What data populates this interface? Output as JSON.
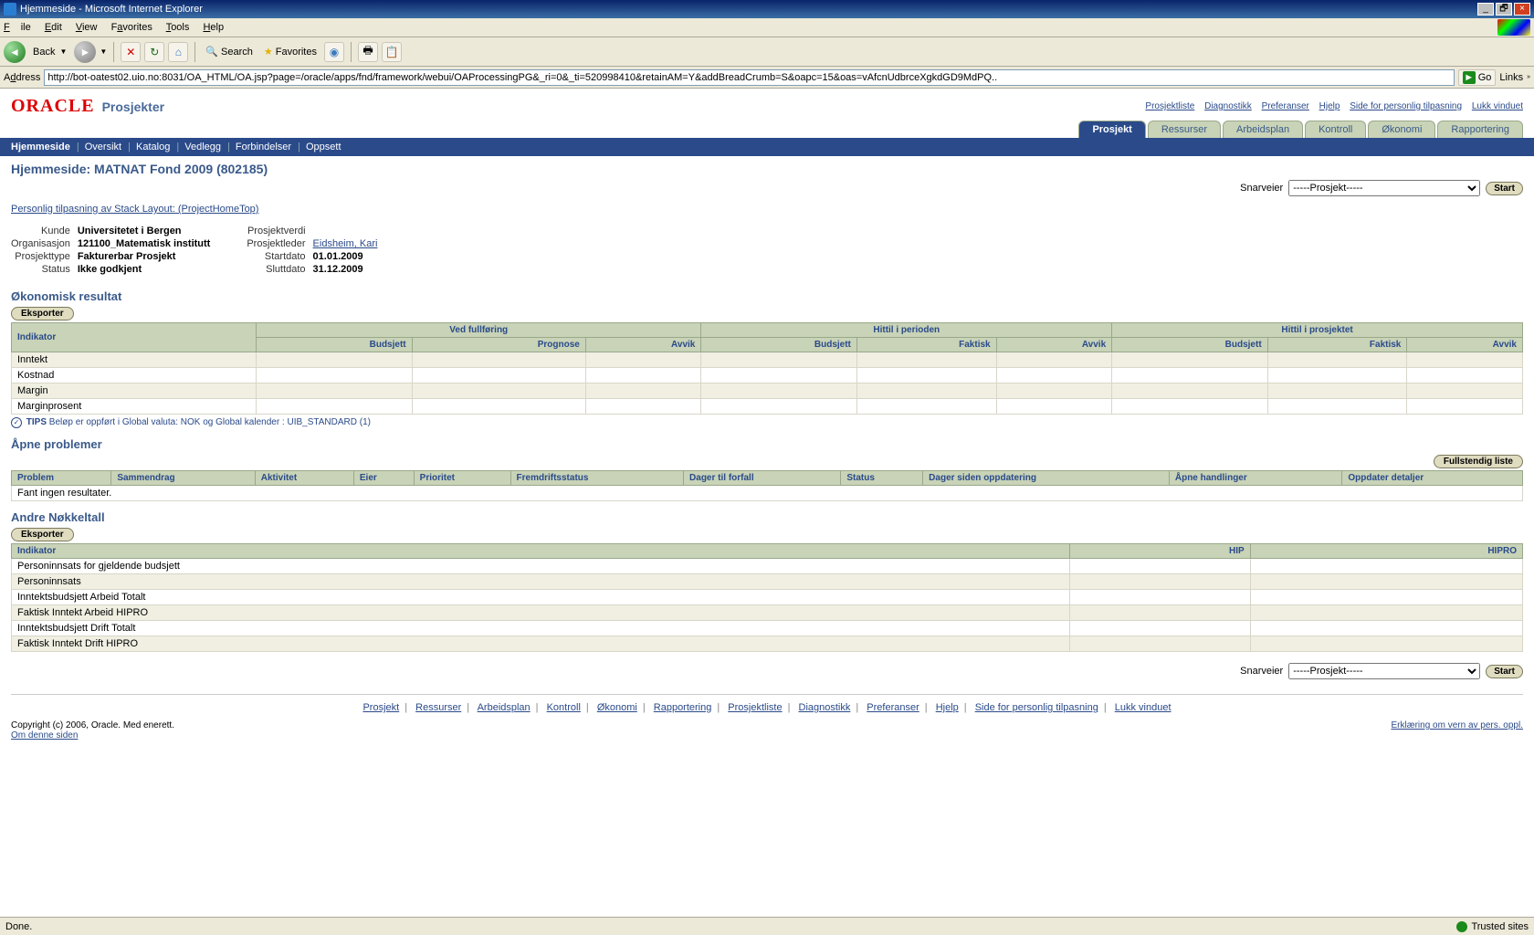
{
  "window": {
    "title": "Hjemmeside - Microsoft Internet Explorer"
  },
  "iemenu": {
    "file": "File",
    "edit": "Edit",
    "view": "View",
    "favorites": "Favorites",
    "tools": "Tools",
    "help": "Help"
  },
  "ietool": {
    "back": "Back",
    "search": "Search",
    "favorites": "Favorites"
  },
  "address": {
    "label": "Address",
    "url": "http://bot-oatest02.uio.no:8031/OA_HTML/OA.jsp?page=/oracle/apps/fnd/framework/webui/OAProcessingPG&_ri=0&_ti=520998410&retainAM=Y&addBreadCrumb=S&oapc=15&oas=vAfcnUdbrceXgkdGD9MdPQ..",
    "go": "Go",
    "links": "Links"
  },
  "oracle": {
    "brand": "ORACLE",
    "sub": "Prosjekter",
    "toplinks": [
      "Prosjektliste",
      "Diagnostikk",
      "Preferanser",
      "Hjelp",
      "Side for personlig tilpasning",
      "Lukk vinduet"
    ]
  },
  "tabs": [
    "Prosjekt",
    "Ressurser",
    "Arbeidsplan",
    "Kontroll",
    "Økonomi",
    "Rapportering"
  ],
  "bluebar": [
    "Hjemmeside",
    "Oversikt",
    "Katalog",
    "Vedlegg",
    "Forbindelser",
    "Oppsett"
  ],
  "page_title": "Hjemmeside: MATNAT Fond 2009 (802185)",
  "snar": {
    "label": "Snarveier",
    "selected": "-----Prosjekt-----",
    "btn": "Start"
  },
  "personlig_link": "Personlig tilpasning av Stack Layout: (ProjectHomeTop)",
  "kv": {
    "kunde_l": "Kunde",
    "kunde_v": "Universitetet i Bergen",
    "org_l": "Organisasjon",
    "org_v": "121100_Matematisk institutt",
    "ptype_l": "Prosjekttype",
    "ptype_v": "Fakturerbar Prosjekt",
    "status_l": "Status",
    "status_v": "Ikke godkjent",
    "pverdi_l": "Prosjektverdi",
    "pverdi_v": "",
    "pleder_l": "Prosjektleder",
    "pleder_v": "Eidsheim, Kari",
    "start_l": "Startdato",
    "start_v": "01.01.2009",
    "slutt_l": "Sluttdato",
    "slutt_v": "31.12.2009"
  },
  "econ": {
    "title": "Økonomisk resultat",
    "eksport": "Eksporter",
    "groups": [
      "Ved fullføring",
      "Hittil i perioden",
      "Hittil i prosjektet"
    ],
    "cols": {
      "indikator": "Indikator",
      "budsjett": "Budsjett",
      "prognose": "Prognose",
      "avvik": "Avvik",
      "faktisk": "Faktisk"
    },
    "rows": [
      "Inntekt",
      "Kostnad",
      "Margin",
      "Marginprosent"
    ],
    "tips_label": "TIPS",
    "tips": "Beløp er oppført i Global valuta: NOK og Global kalender : UIB_STANDARD (1)"
  },
  "probs": {
    "title": "Åpne problemer",
    "full": "Fullstendig liste",
    "cols": [
      "Problem",
      "Sammendrag",
      "Aktivitet",
      "Eier",
      "Prioritet",
      "Fremdriftsstatus",
      "Dager til forfall",
      "Status",
      "Dager siden oppdatering",
      "Åpne handlinger",
      "Oppdater detaljer"
    ],
    "empty": "Fant ingen resultater."
  },
  "nokkel": {
    "title": "Andre Nøkkeltall",
    "eksport": "Eksporter",
    "cols": {
      "indikator": "Indikator",
      "hip": "HIP",
      "hipro": "HIPRO"
    },
    "rows": [
      "Personinnsats for gjeldende budsjett",
      "Personinnsats",
      "Inntektsbudsjett Arbeid Totalt",
      "Faktisk Inntekt Arbeid HIPRO",
      "Inntektsbudsjett Drift Totalt",
      "Faktisk Inntekt Drift HIPRO"
    ]
  },
  "footer": {
    "links": [
      "Prosjekt",
      "Ressurser",
      "Arbeidsplan",
      "Kontroll",
      "Økonomi",
      "Rapportering",
      "Prosjektliste",
      "Diagnostikk",
      "Preferanser",
      "Hjelp",
      "Side for personlig tilpasning",
      "Lukk vinduet"
    ],
    "copy": "Copyright (c) 2006, Oracle. Med enerett.",
    "about": "Om denne siden",
    "privacy": "Erklæring om vern av pers. oppl."
  },
  "status": {
    "done": "Done.",
    "trusted": "Trusted sites"
  }
}
